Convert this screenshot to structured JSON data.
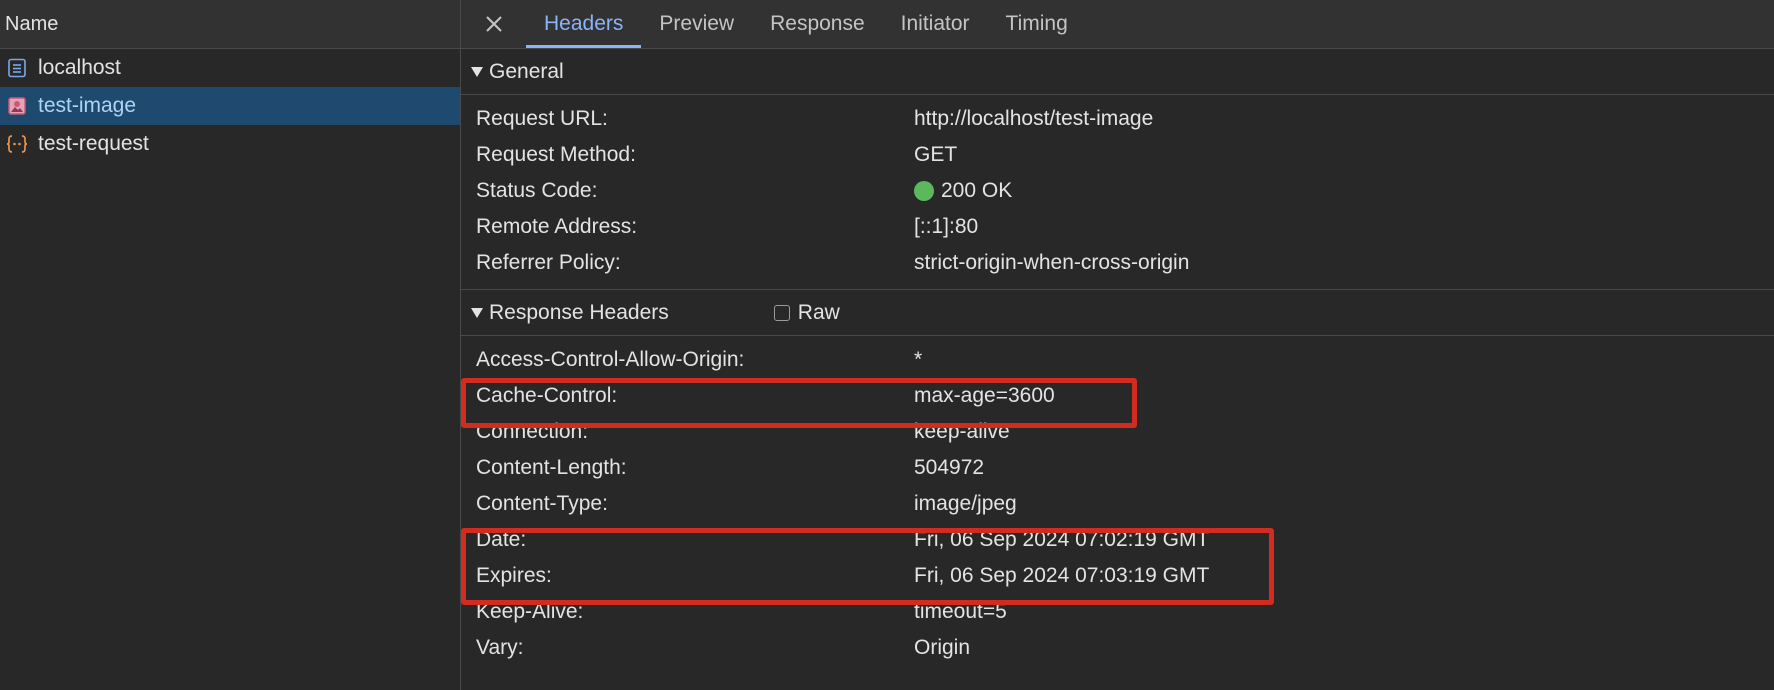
{
  "request_list": {
    "header": "Name",
    "items": [
      {
        "name": "localhost",
        "icon": "document-icon"
      },
      {
        "name": "test-image",
        "icon": "image-icon",
        "selected": true
      },
      {
        "name": "test-request",
        "icon": "fetch-icon"
      }
    ]
  },
  "tabs": {
    "close_icon": "close-icon",
    "items": [
      "Headers",
      "Preview",
      "Response",
      "Initiator",
      "Timing"
    ],
    "active": "Headers"
  },
  "general": {
    "title": "General",
    "rows": [
      {
        "key": "Request URL:",
        "value": "http://localhost/test-image"
      },
      {
        "key": "Request Method:",
        "value": "GET"
      },
      {
        "key": "Status Code:",
        "value": "200 OK"
      },
      {
        "key": "Remote Address:",
        "value": "[::1]:80"
      },
      {
        "key": "Referrer Policy:",
        "value": "strict-origin-when-cross-origin"
      }
    ]
  },
  "response_headers": {
    "title": "Response Headers",
    "raw_label": "Raw",
    "rows": [
      {
        "key": "Access-Control-Allow-Origin:",
        "value": "*"
      },
      {
        "key": "Cache-Control:",
        "value": "max-age=3600"
      },
      {
        "key": "Connection:",
        "value": "keep-alive"
      },
      {
        "key": "Content-Length:",
        "value": "504972"
      },
      {
        "key": "Content-Type:",
        "value": "image/jpeg"
      },
      {
        "key": "Date:",
        "value": "Fri, 06 Sep 2024 07:02:19 GMT"
      },
      {
        "key": "Expires:",
        "value": "Fri, 06 Sep 2024 07:03:19 GMT"
      },
      {
        "key": "Keep-Alive:",
        "value": "timeout=5"
      },
      {
        "key": "Vary:",
        "value": "Origin"
      }
    ]
  },
  "colors": {
    "background": "#282828",
    "selected_row": "#1f4a70",
    "active_tab": "#8ab4f8",
    "status_ok": "#5cb85c",
    "highlight": "#d12c1f"
  }
}
